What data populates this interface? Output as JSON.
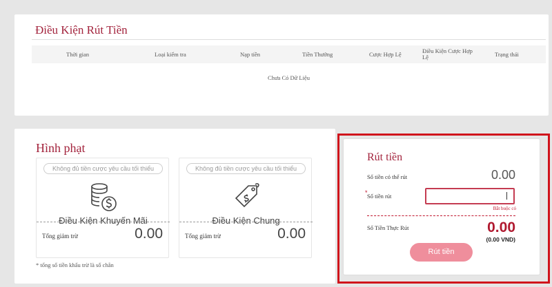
{
  "conditions": {
    "title": "Điều Kiện Rút Tiền",
    "columns": [
      "Thời gian",
      "Loại kiểm tra",
      "Nạp tiền",
      "Tiền Thưởng",
      "Cược Hợp Lệ",
      "Điều Kiện Cược Hợp Lệ",
      "Trạng thái"
    ],
    "empty_text": "Chưa Có Dữ Liệu"
  },
  "penalty": {
    "title": "Hình phạt",
    "cards": [
      {
        "pill": "Không đủ tiền cược yêu cầu tối thiểu",
        "label": "Điều Kiện Khuyến Mãi",
        "total_label": "Tổng giảm trừ",
        "total_value": "0.00"
      },
      {
        "pill": "Không đủ tiền cược yêu cầu tối thiểu",
        "label": "Điều Kiện Chung",
        "total_label": "Tổng giảm trừ",
        "total_value": "0.00"
      }
    ],
    "note": "* tổng số tiền khấu trừ là số chẵn"
  },
  "withdraw": {
    "title": "Rút tiền",
    "available_label": "Số tiền có thể rút",
    "available_value": "0.00",
    "amount_star": "*",
    "amount_label": "Số tiền rút",
    "amount_value": "",
    "required_msg": "Bắt buộc có",
    "actual_label": "Số Tiền Thực Rút",
    "actual_value": "0.00",
    "actual_vnd": "(0.00 VND)",
    "button_label": "Rút tiền"
  },
  "colors": {
    "accent": "#a3243d",
    "highlight_frame": "#d0121b",
    "button": "#ef8e9c"
  }
}
